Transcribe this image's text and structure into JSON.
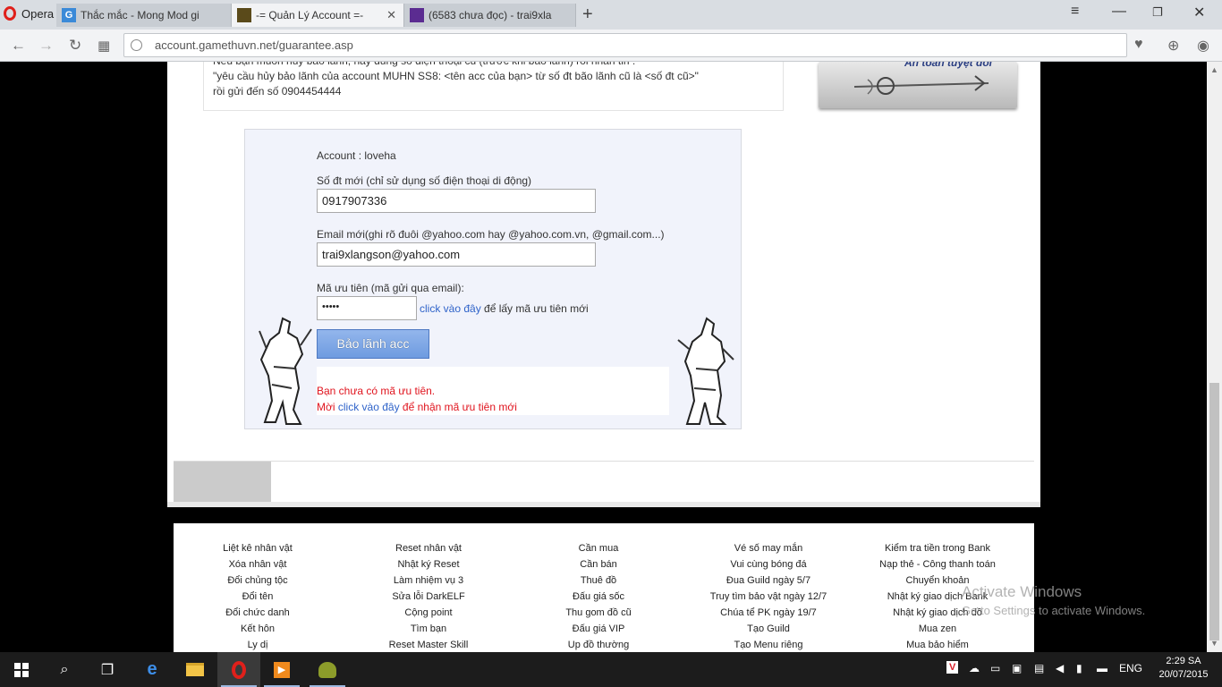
{
  "browser": {
    "menu_label": "Opera",
    "tabs": [
      {
        "title": "Thắc mắc - Mong Mod gi",
        "favicon": "G",
        "color": "#3b8ad8"
      },
      {
        "title": "-= Quản Lý Account =-",
        "favicon": "",
        "color": "#5a4a1a"
      },
      {
        "title": "(6583 chưa đọc) - trai9xla",
        "favicon": "",
        "color": "#5b2c91"
      }
    ],
    "url": "account.gamethuvn.net/guarantee.asp"
  },
  "notice": {
    "line0": "Nếu bạn muốn hủy bảo lãnh, hãy dùng số điện thoại cũ (trước khi bảo lãnh) rồi nhắn tin :",
    "line1": "\"yêu cầu hủy bảo lãnh của account MUHN SS8: <tên acc của bạn> từ số đt bão lãnh cũ là <số đt cũ>\"",
    "line2": "rồi gửi đến số 0904454444"
  },
  "banner": {
    "text": "An toàn tuyệt đối"
  },
  "form": {
    "account_label": "Account : loveha",
    "phone_label": "Số đt mới (chỉ sử dụng số điện thoại di động)",
    "phone_value": "0917907336",
    "email_label": "Email mới(ghi rõ đuôi @yahoo.com hay @yahoo.com.vn, @gmail.com...)",
    "email_value": "trai9xlangson@yahoo.com",
    "code_label": "Mã ưu tiên (mã gửi qua email):",
    "code_value": "•••••",
    "code_link": "click vào đây",
    "code_suffix": " để lấy mã ưu tiên mới",
    "submit_label": "Bảo lãnh acc",
    "msg1": "Bạn chưa có mã ưu tiên.",
    "msg2_prefix": "Mời ",
    "msg2_link": "click vào đây",
    "msg2_suffix": " để nhận mã ưu tiên mới"
  },
  "menu": {
    "col1": [
      "Liệt kê nhân vật",
      "Xóa nhân vật",
      "Đổi chủng tộc",
      "Đổi tên",
      "Đổi chức danh",
      "Kết hôn",
      "Ly dị"
    ],
    "col2": [
      "Reset nhân vật",
      "Nhật ký Reset",
      "Làm nhiệm vụ 3",
      "Sửa lỗi DarkELF",
      "Cộng point",
      "Tìm bạn",
      "Reset Master Skill"
    ],
    "col3": [
      "Cần mua",
      "Cần bán",
      "Thuê đồ",
      "Đấu giá sốc",
      "Thu gom đồ cũ",
      "Đấu giá VIP",
      "Up đồ thường"
    ],
    "col4": [
      "Vé số may mắn",
      "Vui cùng bóng đá",
      "Đua Guild ngày 5/7",
      "Truy tìm bảo vật ngày 12/7",
      "Chúa tể PK ngày 19/7",
      "Tạo Guild",
      "Tạo Menu riêng"
    ],
    "col5": [
      "Kiểm tra tiền trong Bank",
      "Nạp thẻ - Công thanh toán",
      "Chuyển khoản",
      "Nhật ký giao dịch Bank",
      "Nhật ký giao dịch đồ",
      "Mua zen",
      "Mua bảo hiểm"
    ]
  },
  "watermark": {
    "line1": "Activate Windows",
    "line2": "Go to Settings to activate Windows."
  },
  "taskbar": {
    "lang": "ENG",
    "time": "2:29 SA",
    "date": "20/07/2015"
  }
}
